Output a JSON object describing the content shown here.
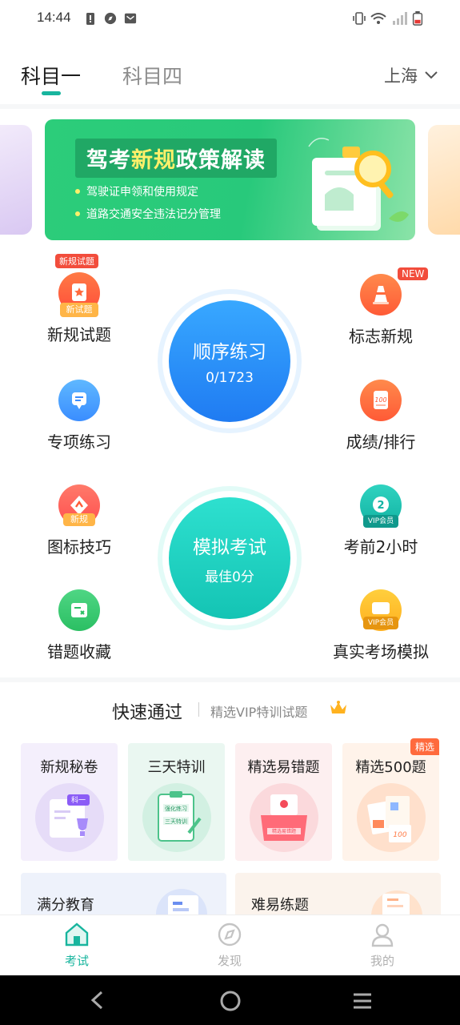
{
  "status_bar": {
    "time": "14:44"
  },
  "header": {
    "tabs": [
      {
        "label": "科目一",
        "active": true
      },
      {
        "label": "科目四",
        "active": false
      }
    ],
    "city": "上海",
    "accent": "#18b59e"
  },
  "banner": {
    "title_prefix": "驾考",
    "title_highlight": "新规",
    "title_suffix": "政策解读",
    "bullets": [
      "驾驶证申领和使用规定",
      "道路交通安全违法记分管理"
    ]
  },
  "features": {
    "new_rules_questions": {
      "label": "新规试题",
      "badge": "新规试题",
      "icon_text": "新试题"
    },
    "sign_new_rules": {
      "label": "标志新规",
      "badge": "NEW"
    },
    "topic_practice": {
      "label": "专项练习"
    },
    "scores_ranking": {
      "label": "成绩/排行",
      "icon_text": "100"
    },
    "icon_tips": {
      "label": "图标技巧",
      "icon_text": "新规"
    },
    "last_two_hours": {
      "label": "考前2小时",
      "icon_text": "VIP会员"
    },
    "wrong_collection": {
      "label": "错题收藏"
    },
    "real_exam_sim": {
      "label": "真实考场模拟",
      "icon_text": "VIP会员"
    }
  },
  "sequential_practice": {
    "title": "顺序练习",
    "progress": "0/1723"
  },
  "mock_exam": {
    "title": "模拟考试",
    "best": "最佳0分"
  },
  "quick_pass": {
    "title": "快速通过",
    "subtitle": "精选VIP特训试题",
    "cards": [
      {
        "label": "新规秘卷",
        "art_text": "科一"
      },
      {
        "label": "三天特训",
        "art_text_1": "强化练习",
        "art_text_2": "三天特训"
      },
      {
        "label": "精选易错题",
        "art_text": "精选易错题"
      },
      {
        "label": "精选500题",
        "badge": "精选",
        "art_text": "100"
      }
    ],
    "wide_cards": [
      {
        "label": "满分教育"
      },
      {
        "label": "难易练题"
      }
    ]
  },
  "bottom_nav": [
    {
      "label": "考试",
      "active": true
    },
    {
      "label": "发现",
      "active": false
    },
    {
      "label": "我的",
      "active": false
    }
  ]
}
